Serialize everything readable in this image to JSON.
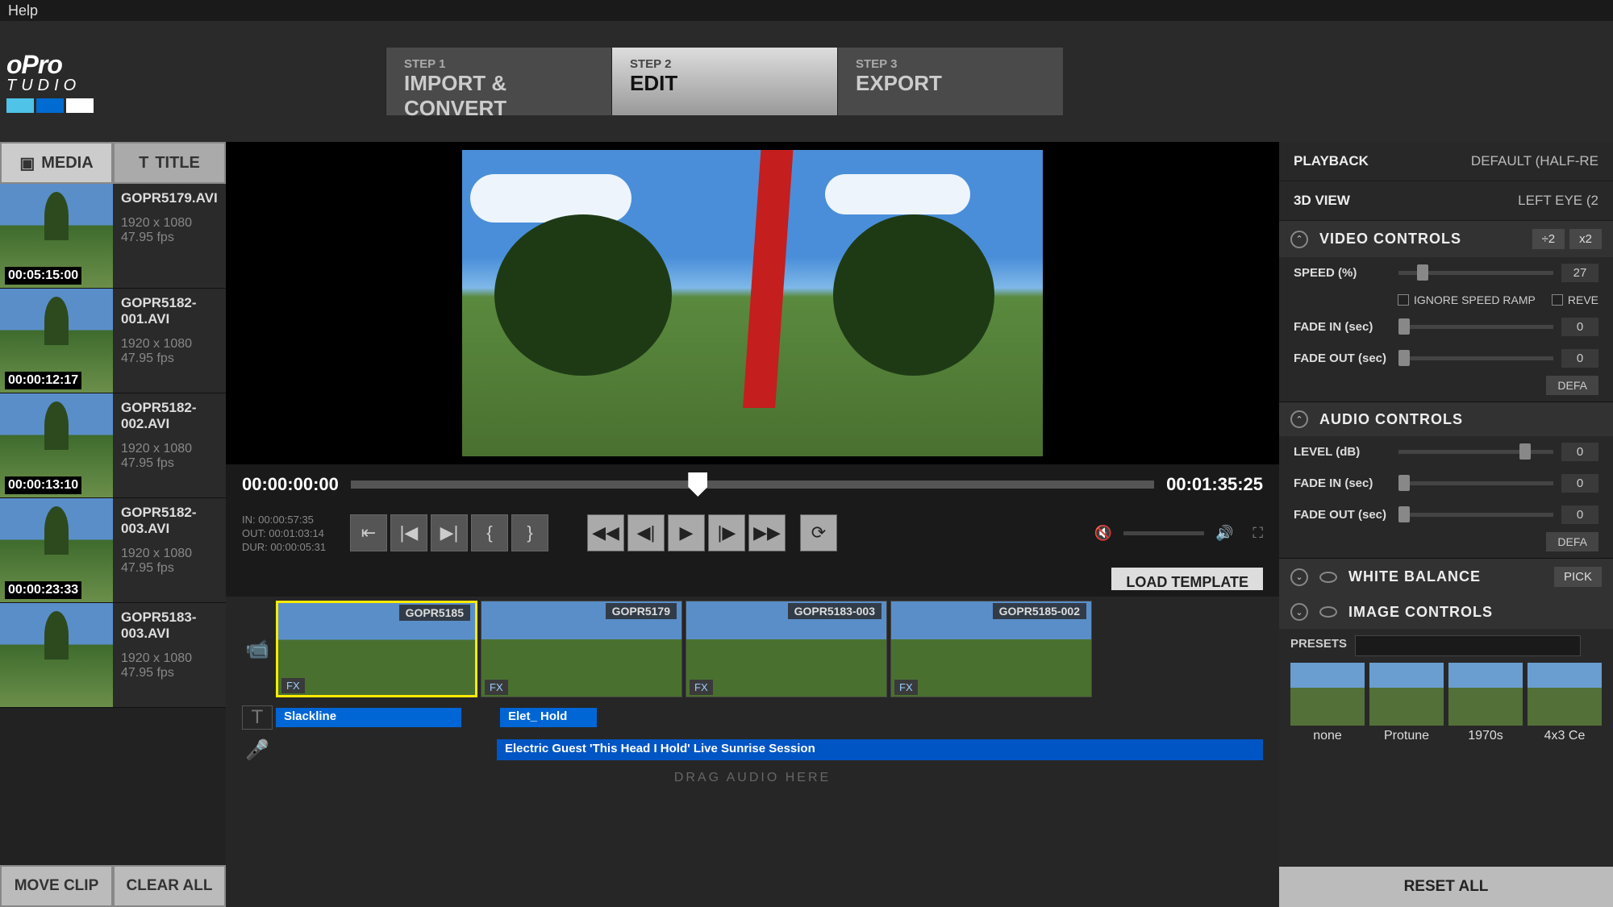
{
  "menu": {
    "help": "Help"
  },
  "logo": {
    "line1": "oPro",
    "line2": "TUDIO"
  },
  "steps": [
    {
      "num": "STEP 1",
      "label": "IMPORT & CONVERT"
    },
    {
      "num": "STEP 2",
      "label": "EDIT"
    },
    {
      "num": "STEP 3",
      "label": "EXPORT"
    }
  ],
  "leftTabs": {
    "media": "MEDIA",
    "title": "TITLE"
  },
  "clips": [
    {
      "file": "GOPR5179.AVI",
      "dim": "1920 x 1080",
      "fps": "47.95 fps",
      "tc": "00:05:15:00"
    },
    {
      "file": "GOPR5182-001.AVI",
      "dim": "1920 x 1080",
      "fps": "47.95 fps",
      "tc": "00:00:12:17"
    },
    {
      "file": "GOPR5182-002.AVI",
      "dim": "1920 x 1080",
      "fps": "47.95 fps",
      "tc": "00:00:13:10"
    },
    {
      "file": "GOPR5182-003.AVI",
      "dim": "1920 x 1080",
      "fps": "47.95 fps",
      "tc": "00:00:23:33"
    },
    {
      "file": "GOPR5183-003.AVI",
      "dim": "1920 x 1080",
      "fps": "47.95 fps",
      "tc": ""
    }
  ],
  "leftBtns": {
    "remove": "MOVE CLIP",
    "clear": "CLEAR ALL"
  },
  "scrub": {
    "cur": "00:00:00:00",
    "end": "00:01:35:25"
  },
  "inout": {
    "in": "IN: 00:00:57:35",
    "out": "OUT: 00:01:03:14",
    "dur": "DUR: 00:00:05:31"
  },
  "loadTemplate": "LOAD TEMPLATE",
  "tlClips": [
    {
      "name": "GOPR5185",
      "fx": "FX"
    },
    {
      "name": "GOPR5179",
      "fx": "FX"
    },
    {
      "name": "GOPR5183-003",
      "fx": "FX"
    },
    {
      "name": "GOPR5185-002",
      "fx": "FX"
    }
  ],
  "titles": {
    "t1": "Slackline",
    "t2": "Elet_ Hold"
  },
  "audioTrack": "Electric Guest  'This Head I Hold' Live Sunrise Session",
  "dragAudio": "DRAG AUDIO HERE",
  "right": {
    "playback": {
      "label": "PLAYBACK",
      "value": "DEFAULT (HALF-RE"
    },
    "view3d": {
      "label": "3D VIEW",
      "value": "LEFT EYE (2"
    },
    "videoControls": {
      "title": "VIDEO CONTROLS",
      "half": "÷2",
      "double": "x2",
      "speed": {
        "label": "SPEED (%)",
        "val": "27"
      },
      "ignore": "IGNORE SPEED RAMP",
      "reverse": "REVE",
      "fadein": {
        "label": "FADE IN (sec)",
        "val": "0"
      },
      "fadeout": {
        "label": "FADE OUT (sec)",
        "val": "0"
      },
      "default": "DEFA"
    },
    "audioControls": {
      "title": "AUDIO CONTROLS",
      "level": {
        "label": "LEVEL (dB)",
        "val": "0"
      },
      "fadein": {
        "label": "FADE IN (sec)",
        "val": "0"
      },
      "fadeout": {
        "label": "FADE OUT (sec)",
        "val": "0"
      },
      "default": "DEFA"
    },
    "wb": {
      "title": "WHITE BALANCE",
      "pick": "PICK"
    },
    "ic": {
      "title": "IMAGE CONTROLS"
    },
    "presets": {
      "label": "PRESETS",
      "items": [
        "none",
        "Protune",
        "1970s",
        "4x3 Ce"
      ]
    },
    "reset": "RESET ALL"
  }
}
